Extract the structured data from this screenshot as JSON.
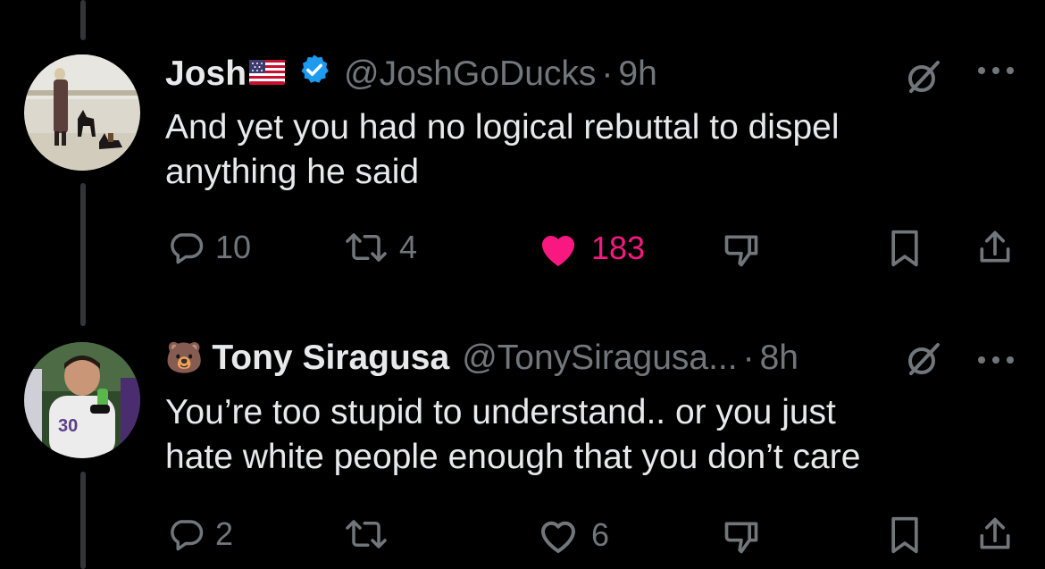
{
  "tweets": [
    {
      "name": "Josh",
      "has_flag": true,
      "verified": true,
      "handle": "@JoshGoDucks",
      "separator": "·",
      "time": "9h",
      "text_line1": "And yet you had no logical rebuttal to dispel",
      "text_line2": "anything he said",
      "replies": "10",
      "retweets": "4",
      "likes": "183",
      "liked": true
    },
    {
      "emoji": "🐻",
      "name": "Tony Siragusa",
      "handle": "@TonySiragusa...",
      "separator": "·",
      "time": "8h",
      "text_line1": "You’re too stupid to understand.. or you just",
      "text_line2": "hate white people enough that you don’t care",
      "replies": "2",
      "retweets": "",
      "likes": "6",
      "liked": false
    }
  ],
  "colors": {
    "background": "#000000",
    "text": "#e7e9ea",
    "muted": "#71767b",
    "like": "#f91880",
    "verified": "#1d9bf0",
    "thread_line": "#333639"
  },
  "icons": [
    "reply-icon",
    "retweet-icon",
    "heart-icon",
    "dislike-icon",
    "bookmark-icon",
    "share-icon",
    "grok-icon",
    "more-icon",
    "verified-icon",
    "us-flag-icon"
  ]
}
